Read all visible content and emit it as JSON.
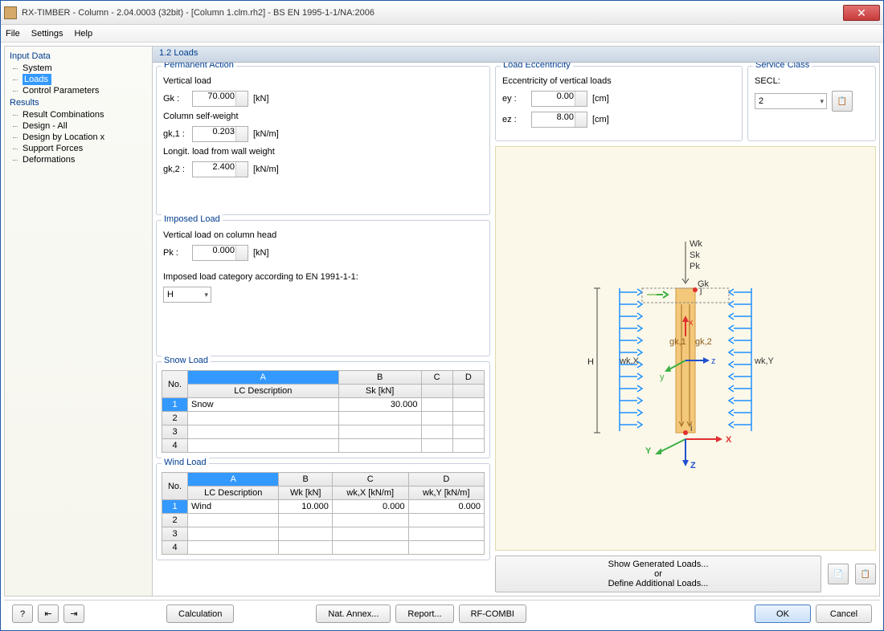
{
  "title": "RX-TIMBER - Column - 2.04.0003 (32bit) - [Column 1.clm.rh2] - BS EN 1995-1-1/NA:2006",
  "menu": {
    "file": "File",
    "settings": "Settings",
    "help": "Help"
  },
  "tree": {
    "group1": "Input Data",
    "items1": {
      "system": "System",
      "loads": "Loads",
      "control": "Control Parameters"
    },
    "group2": "Results",
    "items2": {
      "rc": "Result Combinations",
      "da": "Design - All",
      "dl": "Design by Location x",
      "sf": "Support Forces",
      "de": "Deformations"
    }
  },
  "page": {
    "header": "1.2 Loads"
  },
  "perm": {
    "title": "Permanent Action",
    "vload": "Vertical load",
    "gk_sym": "Gk :",
    "gk_val": "70.000",
    "gk_unit": "[kN]",
    "csw": "Column self-weight",
    "g1_sym": "gk,1 :",
    "g1_val": "0.203",
    "g1_unit": "[kN/m]",
    "lwall": "Longit. load from wall weight",
    "g2_sym": "gk,2 :",
    "g2_val": "2.400",
    "g2_unit": "[kN/m]"
  },
  "imp": {
    "title": "Imposed Load",
    "vhead": "Vertical load on column head",
    "pk_sym": "Pk :",
    "pk_val": "0.000",
    "pk_unit": "[kN]",
    "cat_label": "Imposed load category according to EN 1991-1-1:",
    "cat_val": "H"
  },
  "snow": {
    "title": "Snow Load",
    "cols": {
      "no": "No.",
      "a": "A",
      "b": "B",
      "c": "C",
      "d": "D",
      "desc": "LC Description",
      "sk": "Sk [kN]"
    },
    "rows": [
      {
        "n": "1",
        "desc": "Snow",
        "sk": "30.000"
      },
      {
        "n": "2",
        "desc": "",
        "sk": ""
      },
      {
        "n": "3",
        "desc": "",
        "sk": ""
      },
      {
        "n": "4",
        "desc": "",
        "sk": ""
      }
    ]
  },
  "wind": {
    "title": "Wind Load",
    "cols": {
      "no": "No.",
      "a": "A",
      "b": "B",
      "c": "C",
      "d": "D",
      "desc": "LC Description",
      "wk": "Wk [kN]",
      "wkx": "wk,X [kN/m]",
      "wky": "wk,Y [kN/m]"
    },
    "rows": [
      {
        "n": "1",
        "desc": "Wind",
        "wk": "10.000",
        "wkx": "0.000",
        "wky": "0.000"
      },
      {
        "n": "2",
        "desc": "",
        "wk": "",
        "wkx": "",
        "wky": ""
      },
      {
        "n": "3",
        "desc": "",
        "wk": "",
        "wkx": "",
        "wky": ""
      },
      {
        "n": "4",
        "desc": "",
        "wk": "",
        "wkx": "",
        "wky": ""
      }
    ]
  },
  "ecc": {
    "title": "Load Eccentricity",
    "label": "Eccentricity of vertical loads",
    "ey_sym": "ey :",
    "ey_val": "0.00",
    "ey_unit": "[cm]",
    "ez_sym": "ez :",
    "ez_val": "8.00",
    "ez_unit": "[cm]"
  },
  "svc": {
    "title": "Service Class",
    "secl": "SECL:",
    "val": "2"
  },
  "diag": {
    "Wk": "Wk",
    "Sk": "Sk",
    "Pk": "Pk",
    "Gk": "Gk",
    "g1": "gk,1",
    "g2": "gk,2",
    "wkx": "wk,X",
    "wky": "wk,Y",
    "H": "H",
    "x": "x",
    "y": "y",
    "z": "z",
    "X": "X",
    "Y": "Y",
    "Z": "Z",
    "i": "i",
    "j": "j"
  },
  "bottom": {
    "show": "Show Generated Loads...",
    "or": "or",
    "define": "Define Additional Loads..."
  },
  "footer": {
    "calc": "Calculation",
    "nat": "Nat. Annex...",
    "report": "Report...",
    "rfcombi": "RF-COMBI",
    "ok": "OK",
    "cancel": "Cancel"
  }
}
